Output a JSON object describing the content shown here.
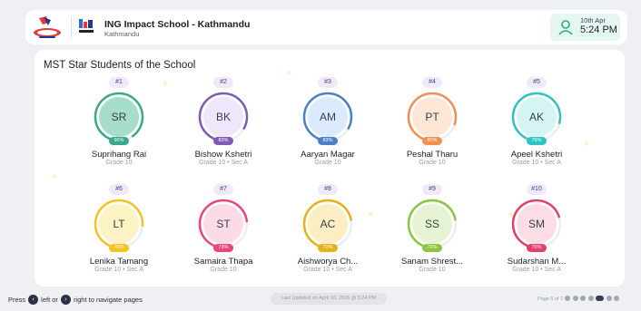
{
  "header": {
    "school_name": "ING Impact School - Kathmandu",
    "city": "Kathmandu",
    "date": "10th Apr",
    "time": "5:24 PM",
    "icons": [
      "second-logo",
      "ing-impact-logo",
      "user-icon"
    ]
  },
  "panel": {
    "title": "MST Star Students of the School"
  },
  "students": [
    {
      "rank": "#1",
      "initials": "SR",
      "percent_label": "90%",
      "progress": 0.9,
      "name": "Suprihang Rai",
      "grade": "Grade 10",
      "color": "#3aa88a",
      "fill": "#a6dec9"
    },
    {
      "rank": "#2",
      "initials": "BK",
      "percent_label": "83%",
      "progress": 0.83,
      "name": "Bishow Kshetri",
      "grade": "Grade 10 • Sec A",
      "color": "#7e5bb5",
      "fill": "#efe6fb"
    },
    {
      "rank": "#3",
      "initials": "AM",
      "percent_label": "83%",
      "progress": 0.83,
      "name": "Aaryan Magar",
      "grade": "Grade 10",
      "color": "#4b80c6",
      "fill": "#dbeafc"
    },
    {
      "rank": "#4",
      "initials": "PT",
      "percent_label": "80%",
      "progress": 0.8,
      "name": "Peshal Tharu",
      "grade": "Grade 10",
      "color": "#f28e52",
      "fill": "#fde6d6"
    },
    {
      "rank": "#5",
      "initials": "AK",
      "percent_label": "79%",
      "progress": 0.79,
      "name": "Apeel Kshetri",
      "grade": "Grade 10 • Sec A",
      "color": "#2ec3c3",
      "fill": "#d4f5f4"
    },
    {
      "rank": "#6",
      "initials": "LT",
      "percent_label": "76%",
      "progress": 0.76,
      "name": "Lenika Tamang",
      "grade": "Grade 10 • Sec A",
      "color": "#f5c21f",
      "fill": "#fdf2c3"
    },
    {
      "rank": "#7",
      "initials": "ST",
      "percent_label": "73%",
      "progress": 0.73,
      "name": "Samaira Thapa",
      "grade": "Grade 10",
      "color": "#e9457e",
      "fill": "#fcdbe7"
    },
    {
      "rank": "#8",
      "initials": "AC",
      "percent_label": "72%",
      "progress": 0.72,
      "name": "Aishworya Ch...",
      "grade": "Grade 10 • Sec A",
      "color": "#e6b21a",
      "fill": "#fbeec3"
    },
    {
      "rank": "#9",
      "initials": "SS",
      "percent_label": "72%",
      "progress": 0.72,
      "name": "Sanam Shrest...",
      "grade": "Grade 10",
      "color": "#8cc63f",
      "fill": "#e7f4d3"
    },
    {
      "rank": "#10",
      "initials": "SM",
      "percent_label": "70%",
      "progress": 0.7,
      "name": "Sudarshan M...",
      "grade": "Grade 10 • Sec A",
      "color": "#e2406a",
      "fill": "#fcdde5"
    }
  ],
  "footer": {
    "nav_prefix": "Press",
    "nav_left": "left or",
    "nav_right": "right to navigate pages",
    "updated": "Last Updated on April 10, 2026 @ 5:24 PM",
    "page_info": "Page 5 of 7",
    "total_pages": 7,
    "current_page": 5
  }
}
